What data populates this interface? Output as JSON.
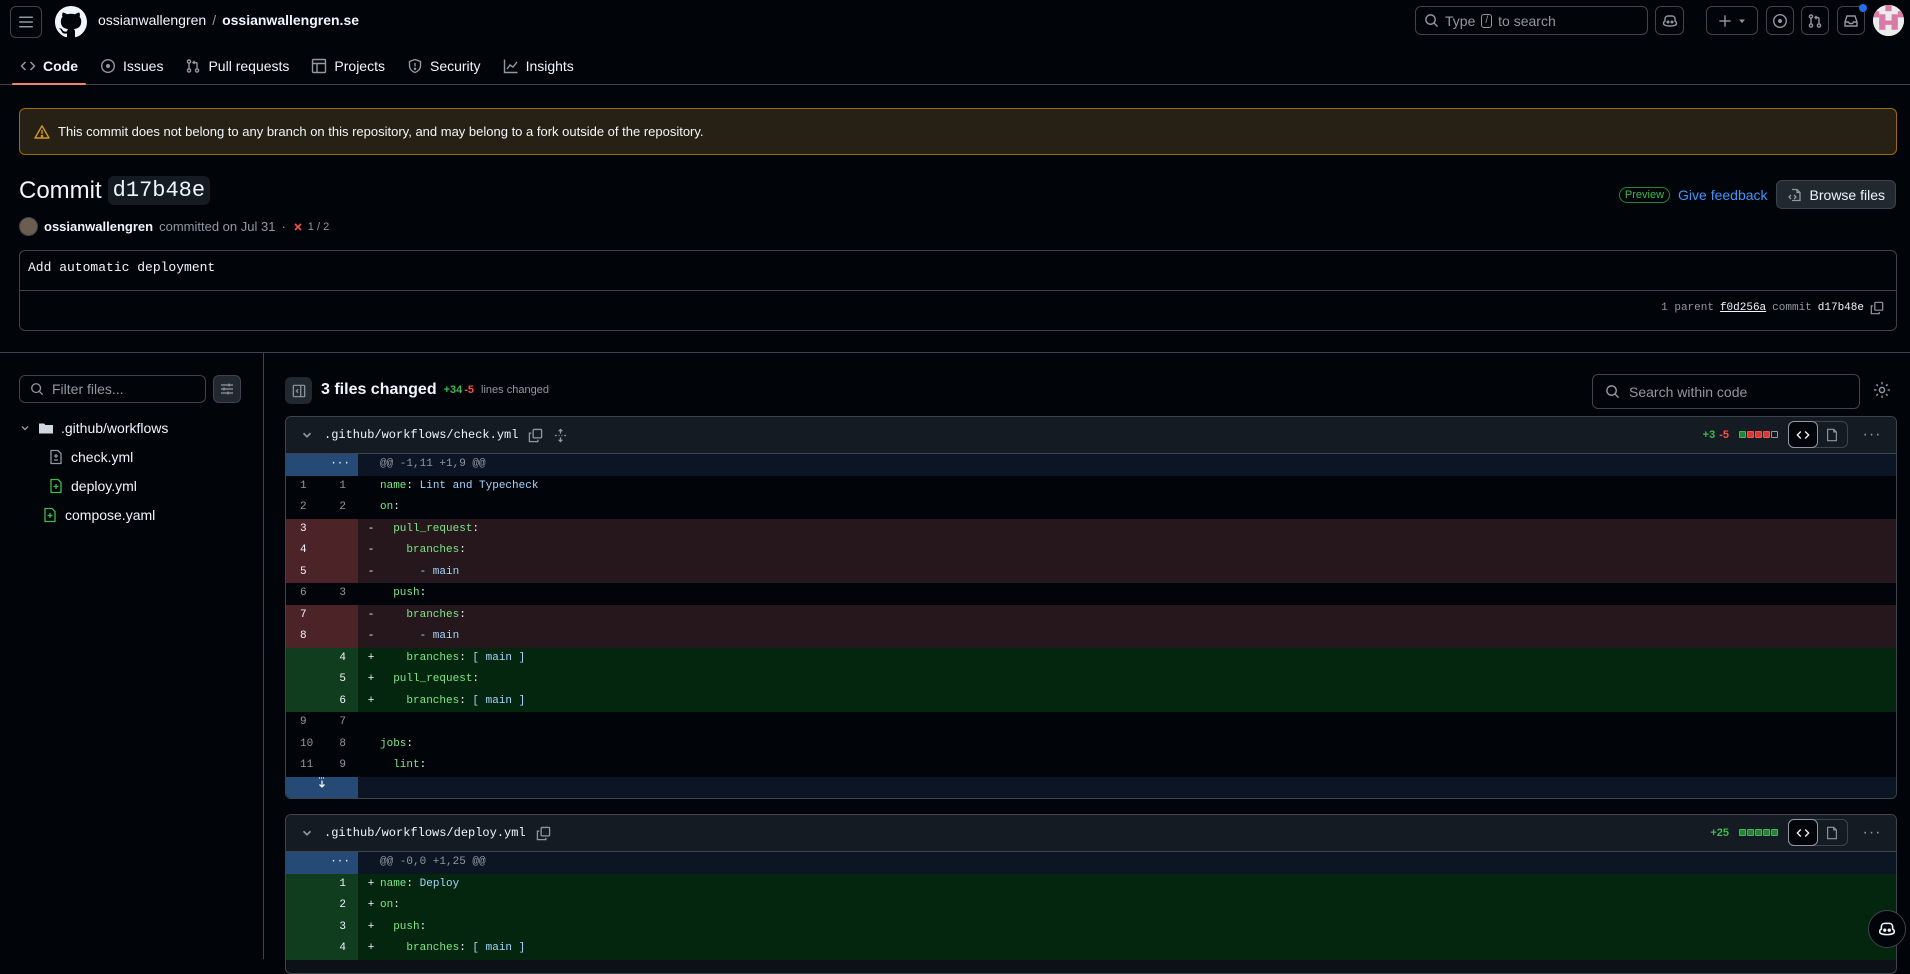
{
  "header": {
    "repo_owner": "ossianwallengren",
    "repo_separator": "/",
    "repo_name": "ossianwallengren.se",
    "search_prefix": "Type",
    "search_key": "/",
    "search_suffix": "to search"
  },
  "tabs": [
    {
      "label": "Code",
      "icon": "code-icon",
      "active": true
    },
    {
      "label": "Issues",
      "icon": "issue-icon",
      "active": false
    },
    {
      "label": "Pull requests",
      "icon": "pull-request-icon",
      "active": false
    },
    {
      "label": "Projects",
      "icon": "table-icon",
      "active": false
    },
    {
      "label": "Security",
      "icon": "shield-icon",
      "active": false
    },
    {
      "label": "Insights",
      "icon": "graph-icon",
      "active": false
    }
  ],
  "banner": {
    "text": "This commit does not belong to any branch on this repository, and may belong to a fork outside of the repository."
  },
  "commit": {
    "title_prefix": "Commit",
    "short_sha": "d17b48e",
    "author": "ossianwallengren",
    "committed_text": "committed on Jul 31",
    "dot": "·",
    "checks": "1 / 2",
    "message": "Add automatic deployment",
    "parent_label": "1 parent",
    "parent_sha": "f0d256a",
    "commit_label": "commit",
    "commit_sha": "d17b48e"
  },
  "actions": {
    "preview_badge": "Preview",
    "feedback": "Give feedback",
    "browse_files": "Browse files"
  },
  "sidebar": {
    "filter_placeholder": "Filter files...",
    "tree": [
      {
        "type": "folder",
        "name": ".github/workflows",
        "depth": 0
      },
      {
        "type": "file-modified",
        "name": "check.yml",
        "depth": 1
      },
      {
        "type": "file-added",
        "name": "deploy.yml",
        "depth": 1
      },
      {
        "type": "file-added",
        "name": "compose.yaml",
        "depth": 0
      }
    ]
  },
  "diff_summary": {
    "title": "3 files changed",
    "additions": "+34",
    "deletions": "-5",
    "suffix": "lines changed",
    "search_placeholder": "Search within code"
  },
  "files": [
    {
      "path": ".github/workflows/check.yml",
      "additions": "+3",
      "deletions": "-5",
      "hunk": "@@ -1,11 +1,9 @@",
      "lines": [
        {
          "type": "ctx",
          "old": "1",
          "new": "1",
          "mark": "",
          "indent": "",
          "key": "name",
          "val": " Lint and Typecheck"
        },
        {
          "type": "ctx",
          "old": "2",
          "new": "2",
          "mark": "",
          "indent": "",
          "key": "on",
          "val": ""
        },
        {
          "type": "del",
          "old": "3",
          "new": "",
          "mark": "-",
          "indent": "  ",
          "key": "pull_request",
          "val": ""
        },
        {
          "type": "del",
          "old": "4",
          "new": "",
          "mark": "-",
          "indent": "    ",
          "key": "branches",
          "val": ""
        },
        {
          "type": "del",
          "old": "5",
          "new": "",
          "mark": "-",
          "indent": "      ",
          "key": "",
          "val": "- main"
        },
        {
          "type": "ctx",
          "old": "6",
          "new": "3",
          "mark": "",
          "indent": "  ",
          "key": "push",
          "val": ""
        },
        {
          "type": "del",
          "old": "7",
          "new": "",
          "mark": "-",
          "indent": "    ",
          "key": "branches",
          "val": ""
        },
        {
          "type": "del",
          "old": "8",
          "new": "",
          "mark": "-",
          "indent": "      ",
          "key": "",
          "val": "- main"
        },
        {
          "type": "add",
          "old": "",
          "new": "4",
          "mark": "+",
          "indent": "    ",
          "key": "branches",
          "val": " [ main ]"
        },
        {
          "type": "add",
          "old": "",
          "new": "5",
          "mark": "+",
          "indent": "  ",
          "key": "pull_request",
          "val": ""
        },
        {
          "type": "add",
          "old": "",
          "new": "6",
          "mark": "+",
          "indent": "    ",
          "key": "branches",
          "val": " [ main ]"
        },
        {
          "type": "ctx",
          "old": "9",
          "new": "7",
          "mark": "",
          "indent": "",
          "key": "",
          "val": ""
        },
        {
          "type": "ctx",
          "old": "10",
          "new": "8",
          "mark": "",
          "indent": "",
          "key": "jobs",
          "val": ""
        },
        {
          "type": "ctx",
          "old": "11",
          "new": "9",
          "mark": "",
          "indent": "  ",
          "key": "lint",
          "val": ""
        }
      ]
    },
    {
      "path": ".github/workflows/deploy.yml",
      "additions": "+25",
      "deletions": "",
      "hunk": "@@ -0,0 +1,25 @@",
      "lines": [
        {
          "type": "add",
          "old": "",
          "new": "1",
          "mark": "+",
          "indent": "",
          "key": "name",
          "val": " Deploy"
        },
        {
          "type": "add",
          "old": "",
          "new": "2",
          "mark": "+",
          "indent": "",
          "key": "on",
          "val": ""
        },
        {
          "type": "add",
          "old": "",
          "new": "3",
          "mark": "+",
          "indent": "  ",
          "key": "push",
          "val": ""
        },
        {
          "type": "add",
          "old": "",
          "new": "4",
          "mark": "+",
          "indent": "    ",
          "key": "branches",
          "val": " [ main ]"
        }
      ]
    }
  ]
}
